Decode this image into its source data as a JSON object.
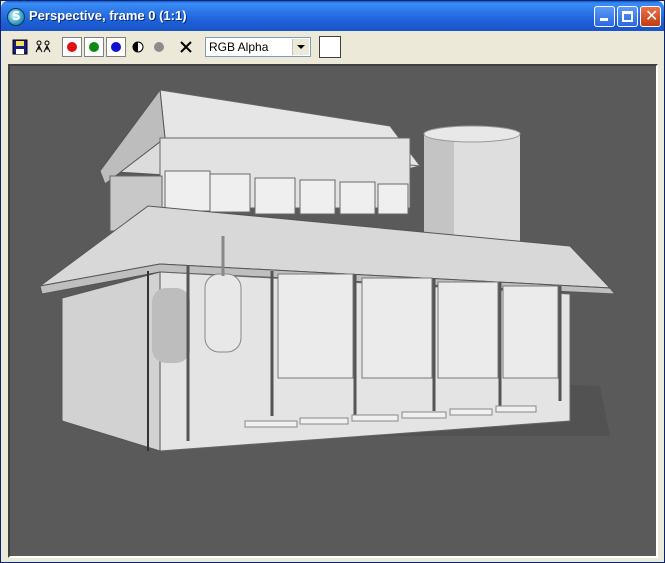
{
  "window": {
    "title": "Perspective, frame 0 (1:1)",
    "app_icon": "3dsmax-icon",
    "buttons": {
      "minimize": "minimize-button",
      "maximize": "maximize-button",
      "close": "close-button"
    }
  },
  "toolbar": {
    "save_icon": "save-icon",
    "clone_icon": "clone-icon",
    "channels": [
      {
        "name": "red-channel-button",
        "color": "#e01010"
      },
      {
        "name": "green-channel-button",
        "color": "#118811"
      },
      {
        "name": "blue-channel-button",
        "color": "#1010d0"
      }
    ],
    "mono_icon": "monochrome-icon",
    "alpha_icon": "alpha-channel-icon",
    "clear_icon": "clear-icon",
    "channel_select": "RGB Alpha",
    "swatch_color": "#ffffff"
  },
  "viewport": {
    "background": "#5a5a5a",
    "content": "rendered-building-image"
  }
}
